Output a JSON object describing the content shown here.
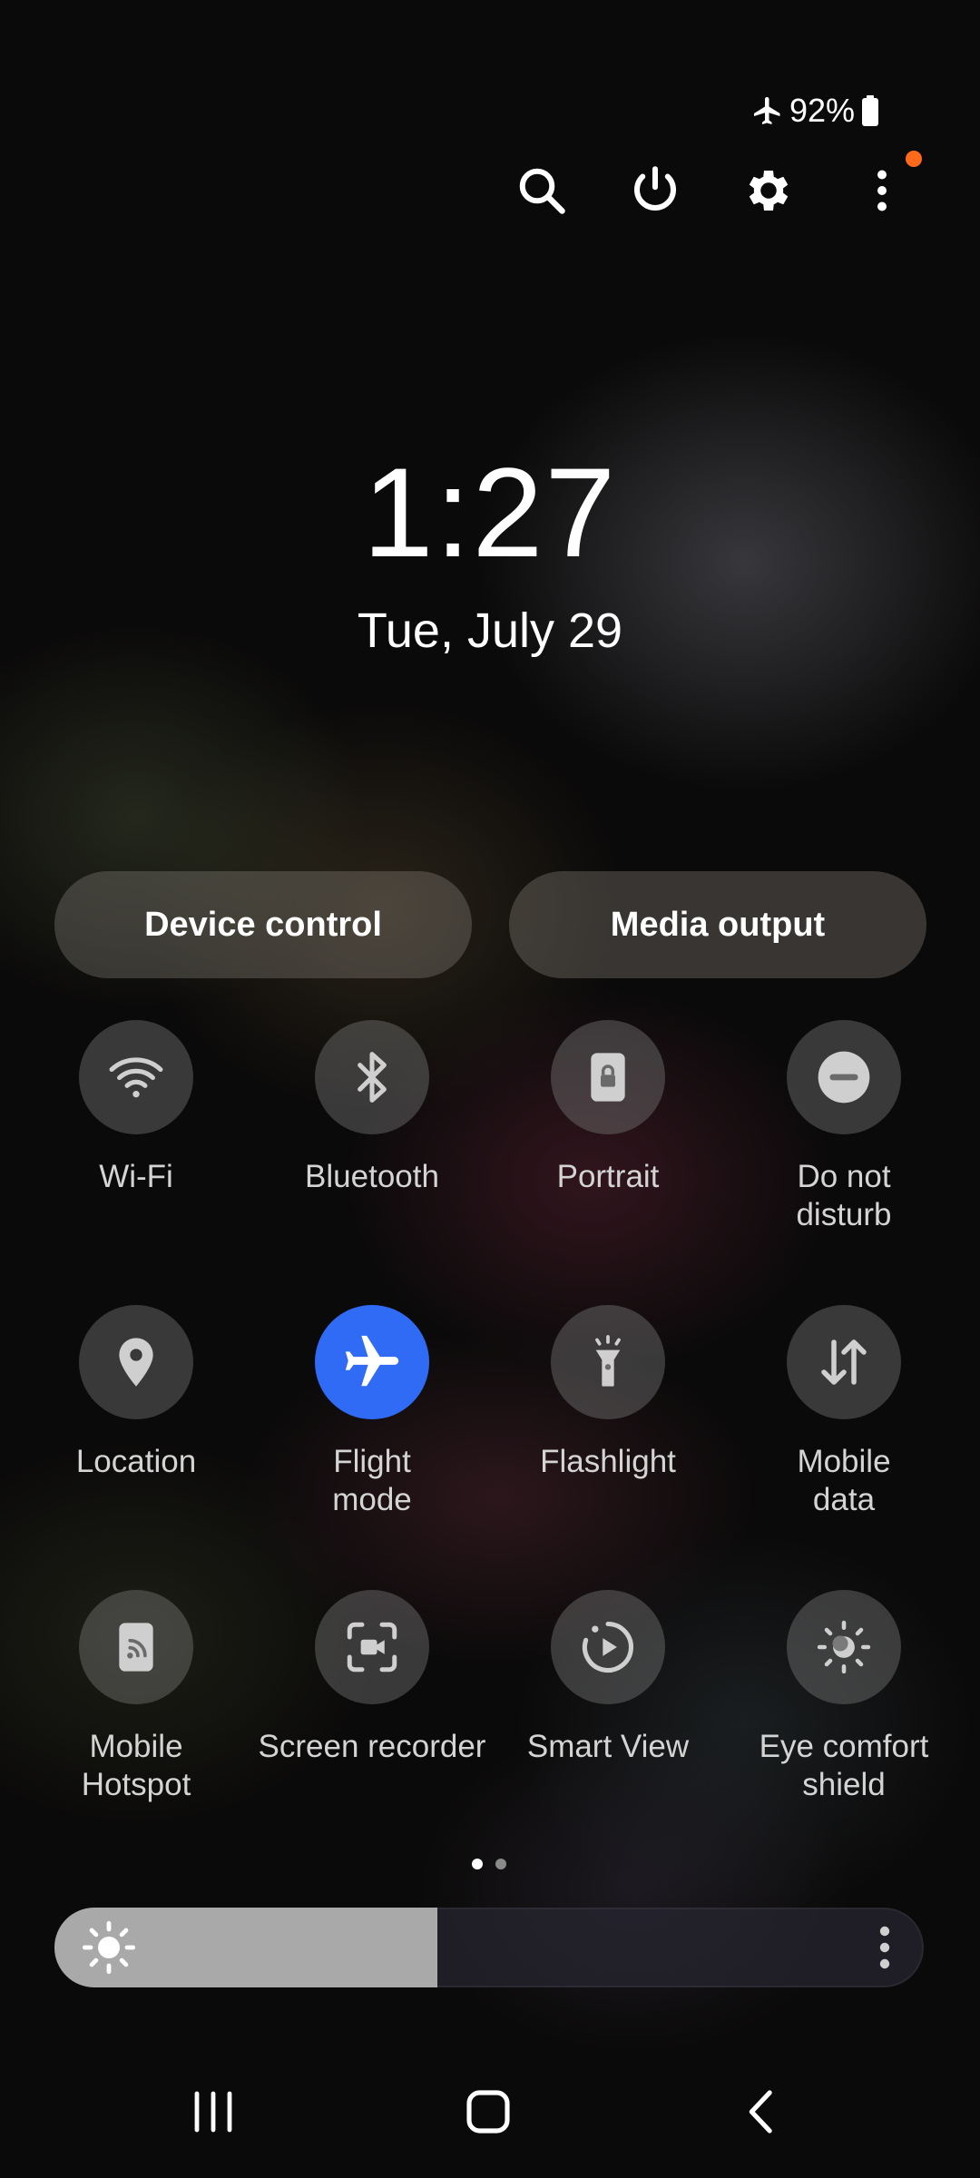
{
  "status_bar": {
    "battery": "92%",
    "airplane_icon": "airplane-icon",
    "battery_icon": "battery-icon"
  },
  "top_actions": [
    {
      "name": "search",
      "icon": "search-icon"
    },
    {
      "name": "power",
      "icon": "power-icon"
    },
    {
      "name": "settings",
      "icon": "gear-icon"
    },
    {
      "name": "more",
      "icon": "more-vertical-icon",
      "notification_dot": true
    }
  ],
  "clock": {
    "time": "1:27",
    "date": "Tue, July 29"
  },
  "buttons": {
    "device_control": "Device control",
    "media_output": "Media output"
  },
  "tiles": [
    {
      "label": "Wi-Fi",
      "icon": "wifi-icon",
      "active": false
    },
    {
      "label": "Bluetooth",
      "icon": "bluetooth-icon",
      "active": false
    },
    {
      "label": "Portrait",
      "icon": "portrait-lock-icon",
      "active": false
    },
    {
      "label": "Do not\ndisturb",
      "icon": "do-not-disturb-icon",
      "active": false
    },
    {
      "label": "Location",
      "icon": "location-pin-icon",
      "active": false
    },
    {
      "label": "Flight\nmode",
      "icon": "airplane-icon",
      "active": true
    },
    {
      "label": "Flashlight",
      "icon": "flashlight-icon",
      "active": false
    },
    {
      "label": "Mobile\ndata",
      "icon": "mobile-data-icon",
      "active": false
    },
    {
      "label": "Mobile\nHotspot",
      "icon": "hotspot-icon",
      "active": false
    },
    {
      "label": "Screen recorder",
      "icon": "screen-recorder-icon",
      "active": false
    },
    {
      "label": "Smart View",
      "icon": "smart-view-icon",
      "active": false
    },
    {
      "label": "Eye comfort\nshield",
      "icon": "eye-comfort-icon",
      "active": false
    }
  ],
  "pager": {
    "pages": 2,
    "current": 1
  },
  "brightness": {
    "level": 0.44,
    "icon": "sun-icon"
  },
  "nav": {
    "recents": "recents-icon",
    "home": "home-icon",
    "back": "back-icon"
  },
  "colors": {
    "accent": "#2f6bf5",
    "notification": "#ff6a1a"
  }
}
